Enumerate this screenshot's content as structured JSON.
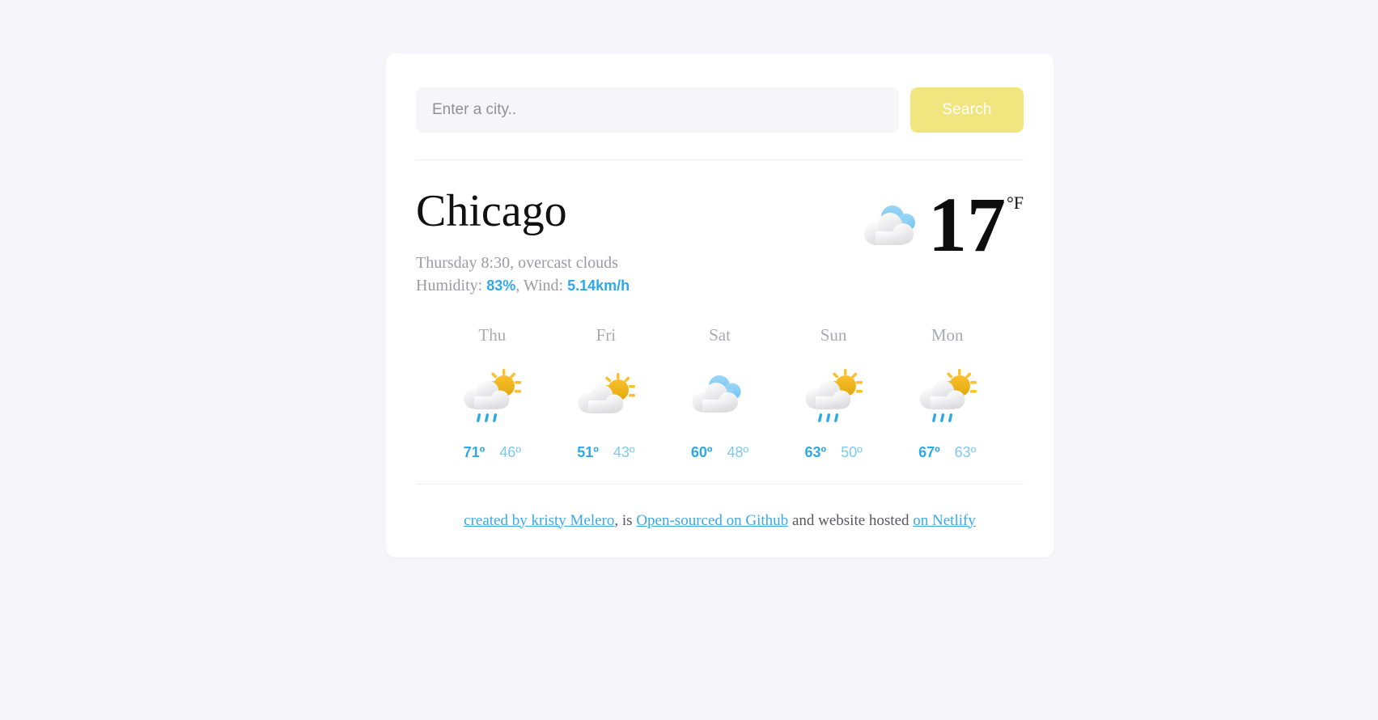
{
  "theme": {
    "page_background": "#f6f5fa",
    "card_background": "#ffffff",
    "accent_yellow": "#f0e57e",
    "accent_blue": "#2fa8e8",
    "accent_blue_light": "#7dc9ef",
    "muted_text": "#a9a9b6"
  },
  "search": {
    "placeholder": "Enter a city..",
    "value": "",
    "button_label": "Search"
  },
  "current": {
    "city": "Chicago",
    "conditions_line": "Thursday 8:30, overcast clouds",
    "humidity_label": "Humidity: ",
    "humidity_value": "83%",
    "wind_separator": ", Wind: ",
    "wind_value": "5.14km/h",
    "temperature": "17",
    "unit": "°F",
    "icon": "overcast-clouds-icon"
  },
  "forecast": [
    {
      "day": "Thu",
      "icon": "sun-behind-cloud-rain-icon",
      "max": "71º",
      "min": "46º"
    },
    {
      "day": "Fri",
      "icon": "sun-behind-cloud-icon",
      "max": "51º",
      "min": "43º"
    },
    {
      "day": "Sat",
      "icon": "overcast-clouds-icon",
      "max": "60º",
      "min": "48º"
    },
    {
      "day": "Sun",
      "icon": "sun-behind-cloud-rain-icon",
      "max": "63º",
      "min": "50º"
    },
    {
      "day": "Mon",
      "icon": "sun-behind-cloud-rain-icon",
      "max": "67º",
      "min": "63º"
    }
  ],
  "footer": {
    "link_author": "created by kristy Melero",
    "text_1": ", is ",
    "link_github": "Open-sourced on Github",
    "text_2": " and website hosted ",
    "link_netlify": "on Netlify"
  }
}
